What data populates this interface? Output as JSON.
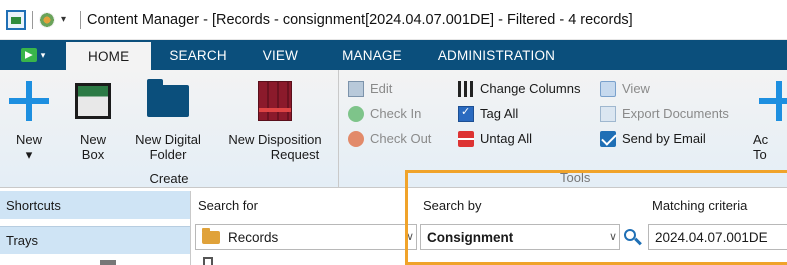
{
  "titlebar": {
    "title": "Content Manager - [Records - consignment[2024.04.07.001DE] - Filtered - 4 records]",
    "qat_arrow": "▾"
  },
  "tabs": {
    "file_caret": "▾",
    "items": [
      {
        "label": "HOME",
        "active": true
      },
      {
        "label": "SEARCH",
        "active": false
      },
      {
        "label": "VIEW",
        "active": false
      },
      {
        "label": "MANAGE",
        "active": false
      },
      {
        "label": "ADMINISTRATION",
        "active": false
      }
    ]
  },
  "ribbon": {
    "create_group": {
      "label": "Create",
      "buttons": [
        {
          "line1": "New",
          "line2": "▾"
        },
        {
          "line1": "New",
          "line2": "Box"
        },
        {
          "line1": "New Digital",
          "line2": "Folder"
        },
        {
          "line1": "New Disposition",
          "line2": "Request"
        }
      ]
    },
    "tools_group": {
      "label": "Tools",
      "col1": [
        "Edit",
        "Check In",
        "Check Out"
      ],
      "col2": [
        "Change Columns",
        "Tag All",
        "Untag All"
      ],
      "col3": [
        "View",
        "Export Documents",
        "Send by Email"
      ],
      "add_button": {
        "line1": "Ac",
        "line2": "To"
      }
    }
  },
  "left_panel": {
    "shortcuts": "Shortcuts",
    "trays": "Trays"
  },
  "search_pane": {
    "search_for_label": "Search for",
    "search_for_value": "Records",
    "search_by_label": "Search by",
    "search_by_value": "Consignment",
    "matching_label": "Matching criteria",
    "matching_value": "2024.04.07.001DE",
    "dropdown_glyph": "∨"
  },
  "colors": {
    "ribbon_tab_bar": "#0b4f7c",
    "accent_blue": "#1d8fe0",
    "highlight_orange": "#f0a32a",
    "panel_header": "#cfe4f5"
  }
}
